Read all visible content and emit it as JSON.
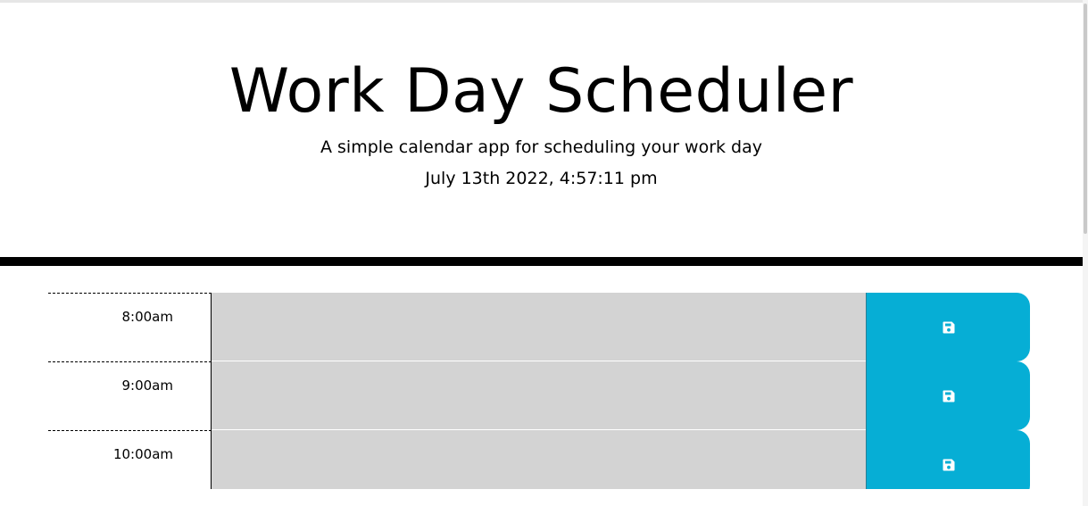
{
  "header": {
    "title": "Work Day Scheduler",
    "subtitle": "A simple calendar app for scheduling your work day",
    "current_day": "July 13th 2022, 4:57:11 pm"
  },
  "time_blocks": [
    {
      "hour": "8:00am",
      "description": "",
      "save_icon": "floppy-disk-icon"
    },
    {
      "hour": "9:00am",
      "description": "",
      "save_icon": "floppy-disk-icon"
    },
    {
      "hour": "10:00am",
      "description": "",
      "save_icon": "floppy-disk-icon"
    }
  ],
  "colors": {
    "past": "#d3d3d3",
    "save_button": "#06aed5",
    "divider": "#000000"
  }
}
